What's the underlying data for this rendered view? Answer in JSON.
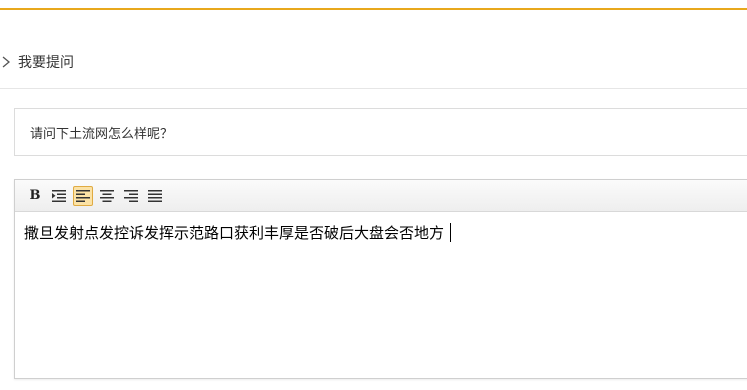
{
  "breadcrumb": {
    "icon": "chevron-right-icon",
    "title": "我要提问"
  },
  "question": {
    "value": "请问下土流网怎么样呢？"
  },
  "editor": {
    "toolbar": [
      {
        "name": "bold-button",
        "icon": "bold-icon",
        "label": "B",
        "active": false
      },
      {
        "name": "indent-button",
        "icon": "indent-icon",
        "active": false
      },
      {
        "name": "align-left-button",
        "icon": "align-left-icon",
        "active": true
      },
      {
        "name": "align-center-button",
        "icon": "align-center-icon",
        "active": false
      },
      {
        "name": "align-right-button",
        "icon": "align-right-icon",
        "active": false
      },
      {
        "name": "align-justify-button",
        "icon": "align-justify-icon",
        "active": false
      }
    ],
    "content": "撒旦发射点发控诉发挥示范路口获利丰厚是否破后大盘会否地方"
  },
  "colors": {
    "accent": "#e8a81c",
    "active_button_bg": "#fbe2a6",
    "active_button_border": "#e0ab42"
  }
}
